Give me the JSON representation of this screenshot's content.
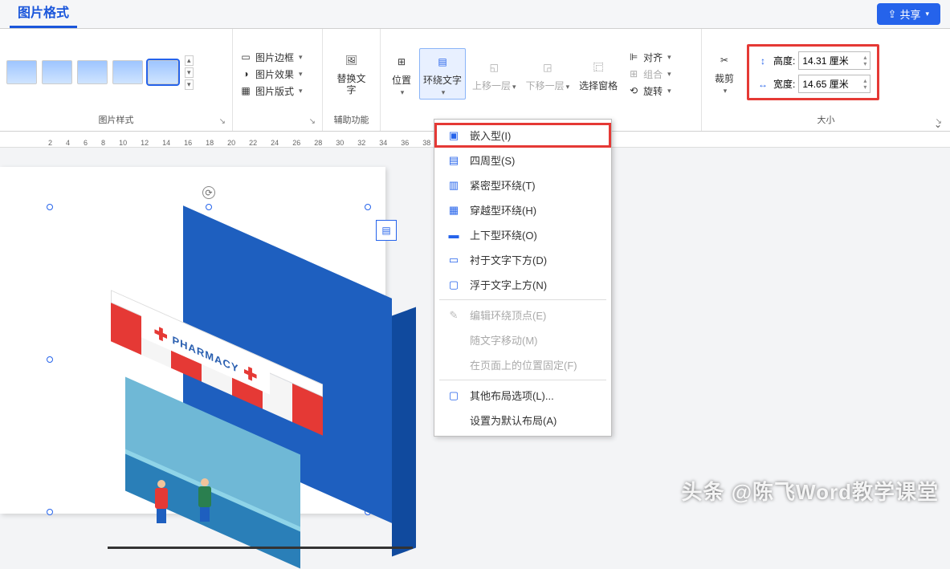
{
  "tab": {
    "title": "图片格式"
  },
  "share": {
    "label": "共享"
  },
  "ribbon": {
    "styles_label": "图片样式",
    "border_label": "图片边框",
    "effects_label": "图片效果",
    "layout_label": "图片版式",
    "replace_text": "替换文字",
    "aux_label": "辅助功能",
    "position": "位置",
    "wrap": "环绕文字",
    "bring_fwd": "上移一层",
    "send_back": "下移一层",
    "select_pane": "选择窗格",
    "align": "对齐",
    "group": "组合",
    "rotate": "旋转",
    "crop": "裁剪",
    "height_label": "高度:",
    "width_label": "宽度:",
    "height_value": "14.31 厘米",
    "width_value": "14.65 厘米",
    "size_label": "大小"
  },
  "ruler": [
    "2",
    "4",
    "6",
    "8",
    "10",
    "12",
    "14",
    "16",
    "18",
    "20",
    "22",
    "24",
    "26",
    "28",
    "30",
    "32",
    "34",
    "36",
    "38"
  ],
  "dropdown": {
    "inline": "嵌入型(I)",
    "square": "四周型(S)",
    "tight": "紧密型环绕(T)",
    "through": "穿越型环绕(H)",
    "topbottom": "上下型环绕(O)",
    "behind": "衬于文字下方(D)",
    "front": "浮于文字上方(N)",
    "edit_points": "编辑环绕顶点(E)",
    "move_with_text": "随文字移动(M)",
    "fix_position": "在页面上的位置固定(F)",
    "more_layout": "其他布局选项(L)...",
    "set_default": "设置为默认布局(A)"
  },
  "image": {
    "sign_text": "PHARMACY"
  },
  "watermark": "头条 @陈飞Word教学课堂"
}
